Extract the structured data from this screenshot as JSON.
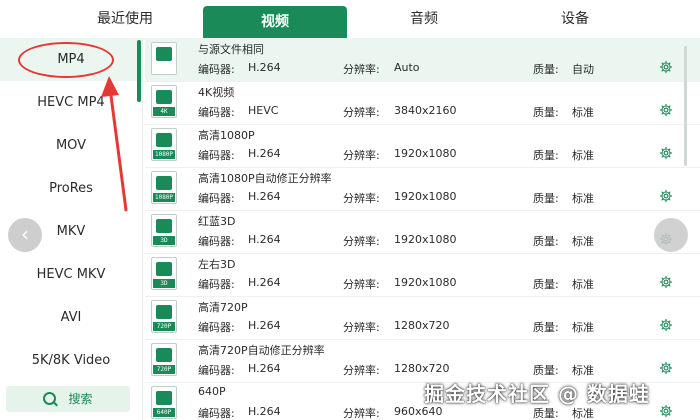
{
  "tabs": [
    {
      "label": "最近使用"
    },
    {
      "label": "视频"
    },
    {
      "label": "音频"
    },
    {
      "label": "设备"
    }
  ],
  "sidebar": {
    "items": [
      {
        "label": "MP4"
      },
      {
        "label": "HEVC MP4"
      },
      {
        "label": "MOV"
      },
      {
        "label": "ProRes"
      },
      {
        "label": "MKV"
      },
      {
        "label": "HEVC MKV"
      },
      {
        "label": "AVI"
      },
      {
        "label": "5K/8K Video"
      }
    ],
    "search_label": "搜索"
  },
  "labels": {
    "codec": "编码器:",
    "resolution": "分辨率:",
    "quality": "质量:"
  },
  "presets": [
    {
      "name": "与源文件相同",
      "badge": "",
      "codec": "H.264",
      "resolution": "Auto",
      "quality": "自动"
    },
    {
      "name": "4K视频",
      "badge": "4K",
      "codec": "HEVC",
      "resolution": "3840x2160",
      "quality": "标准"
    },
    {
      "name": "高清1080P",
      "badge": "1080P",
      "codec": "H.264",
      "resolution": "1920x1080",
      "quality": "标准"
    },
    {
      "name": "高清1080P自动修正分辨率",
      "badge": "1080P",
      "codec": "H.264",
      "resolution": "1920x1080",
      "quality": "标准"
    },
    {
      "name": "红蓝3D",
      "badge": "3D",
      "codec": "H.264",
      "resolution": "1920x1080",
      "quality": "标准"
    },
    {
      "name": "左右3D",
      "badge": "3D",
      "codec": "H.264",
      "resolution": "1920x1080",
      "quality": "标准"
    },
    {
      "name": "高清720P",
      "badge": "720P",
      "codec": "H.264",
      "resolution": "1280x720",
      "quality": "标准"
    },
    {
      "name": "高清720P自动修正分辨率",
      "badge": "720P",
      "codec": "H.264",
      "resolution": "1280x720",
      "quality": "标准"
    },
    {
      "name": "640P",
      "badge": "640P",
      "codec": "H.264",
      "resolution": "960x640",
      "quality": "标准"
    }
  ],
  "icons": {
    "settings": "gear-icon",
    "search": "search-icon",
    "prev": "chevron-left-icon",
    "next": "chevron-right-icon"
  },
  "watermark": "掘金技术社区 @ 数据蛙",
  "colors": {
    "accent": "#1a8a58",
    "selected_bg": "#eaf6ef",
    "annotation": "#e53935"
  }
}
